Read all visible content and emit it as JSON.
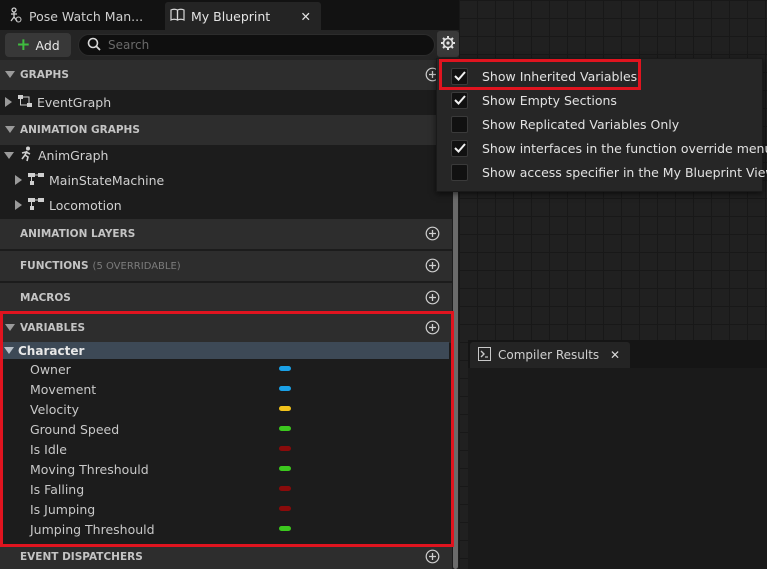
{
  "tabs": {
    "pose_watch": "Pose Watch Man...",
    "my_blueprint": "My Blueprint",
    "close_glyph": "✕"
  },
  "toolbar": {
    "add_label": "Add",
    "search_placeholder": "Search"
  },
  "sections": {
    "graphs": "GRAPHS",
    "animation_graphs": "ANIMATION GRAPHS",
    "animation_layers": "ANIMATION LAYERS",
    "functions": "FUNCTIONS",
    "functions_sub": "(5 OVERRIDABLE)",
    "macros": "MACROS",
    "variables": "VARIABLES",
    "event_dispatchers": "EVENT DISPATCHERS"
  },
  "tree": {
    "event_graph": "EventGraph",
    "anim_graph": "AnimGraph",
    "main_state_machine": "MainStateMachine",
    "locomotion": "Locomotion"
  },
  "category": "Character",
  "variables": [
    {
      "name": "Owner",
      "color": "#1aa0e6"
    },
    {
      "name": "Movement",
      "color": "#1aa0e6"
    },
    {
      "name": "Velocity",
      "color": "#f2c21b"
    },
    {
      "name": "Ground Speed",
      "color": "#3cc81e"
    },
    {
      "name": "Is Idle",
      "color": "#8a0b0b"
    },
    {
      "name": "Moving Threshould",
      "color": "#3cc81e"
    },
    {
      "name": "Is Falling",
      "color": "#8a0b0b"
    },
    {
      "name": "Is Jumping",
      "color": "#8a0b0b"
    },
    {
      "name": "Jumping Threshould",
      "color": "#3cc81e"
    }
  ],
  "menu": [
    {
      "label": "Show Inherited Variables",
      "checked": true
    },
    {
      "label": "Show Empty Sections",
      "checked": true
    },
    {
      "label": "Show Replicated Variables Only",
      "checked": false
    },
    {
      "label": "Show interfaces in the function override menu",
      "checked": true
    },
    {
      "label": "Show access specifier in the My Blueprint View",
      "checked": false
    }
  ],
  "compiler": {
    "tab_label": "Compiler Results",
    "close_glyph": "✕"
  },
  "colors": {
    "highlight_red": "#e0141f",
    "category_bg": "#3d4956",
    "add_green": "#3fbd3f"
  }
}
